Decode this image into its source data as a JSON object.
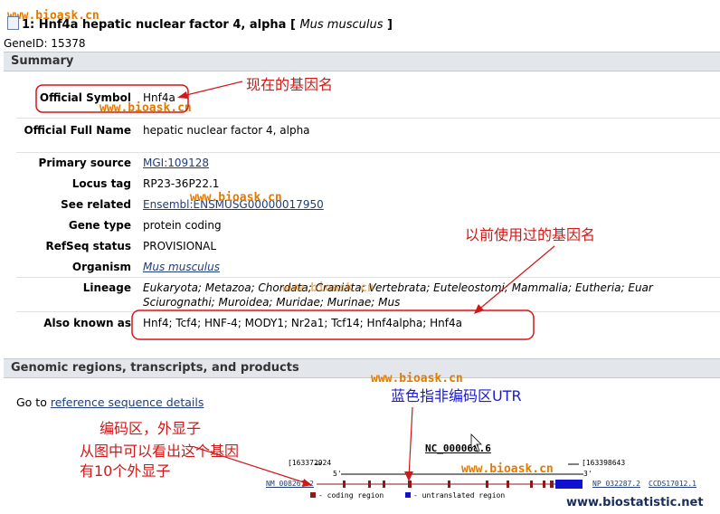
{
  "watermarks": {
    "text": "www.bioask.cn",
    "footer": "www.biostatistic.net"
  },
  "header": {
    "title_prefix": "1: Hnf4a hepatic nuclear factor 4, alpha [ ",
    "organism": "Mus musculus",
    "title_suffix": " ]",
    "gene_id": "GeneID: 15378"
  },
  "summary": {
    "heading": "Summary",
    "rows": [
      {
        "label": "Official Symbol",
        "value": "Hnf4a"
      },
      {
        "label": "Official Full Name",
        "value": "hepatic nuclear factor 4, alpha"
      },
      {
        "label": "Primary source",
        "value": "MGI:109128"
      },
      {
        "label": "Locus tag",
        "value": "RP23-36P22.1"
      },
      {
        "label": "See related",
        "value": "Ensembl:ENSMUSG00000017950"
      },
      {
        "label": "Gene type",
        "value": "protein coding"
      },
      {
        "label": "RefSeq status",
        "value": "PROVISIONAL"
      },
      {
        "label": "Organism",
        "value": "Mus musculus"
      },
      {
        "label": "Lineage",
        "value": "Eukaryota; Metazoa; Chordata; Craniata; Vertebrata; Euteleostomi; Mammalia; Eutheria; Euar",
        "value2": "Sciurognathi; Muroidea; Muridae; Murinae; Mus"
      },
      {
        "label": "Also known as",
        "value": "Hnf4; Tcf4; HNF-4; MODY1; Nr2a1; Tcf14; Hnf4alpha; Hnf4a"
      }
    ]
  },
  "genomic": {
    "heading": "Genomic regions, transcripts, and products",
    "goto_prefix": "Go to ",
    "goto_link": "reference sequence details",
    "accession": "NC_000068.6",
    "start": "[163372924",
    "end": "[163398643",
    "five": "5'",
    "three": "3'",
    "nm": "NM_008261.2",
    "np": "NP_032287.2",
    "ccds": "CCDS17012.1",
    "legend_coding": "- coding region",
    "legend_utr": "- untranslated region"
  },
  "annotations": {
    "current_name": "现在的基因名",
    "previous_names": "以前使用过的基因名",
    "utr_note": "蓝色指非编码区UTR",
    "exon_title": "编码区，外显子",
    "exon_line1": "从图中可以看出这个基因",
    "exon_line2": "有10个外显子"
  },
  "colors": {
    "annotation_red": "#d01818",
    "annotation_blue": "#1a1ad0",
    "watermark_orange": "#e07b00",
    "coding_exon": "#8b1a1a",
    "utr": "#1010d0"
  }
}
